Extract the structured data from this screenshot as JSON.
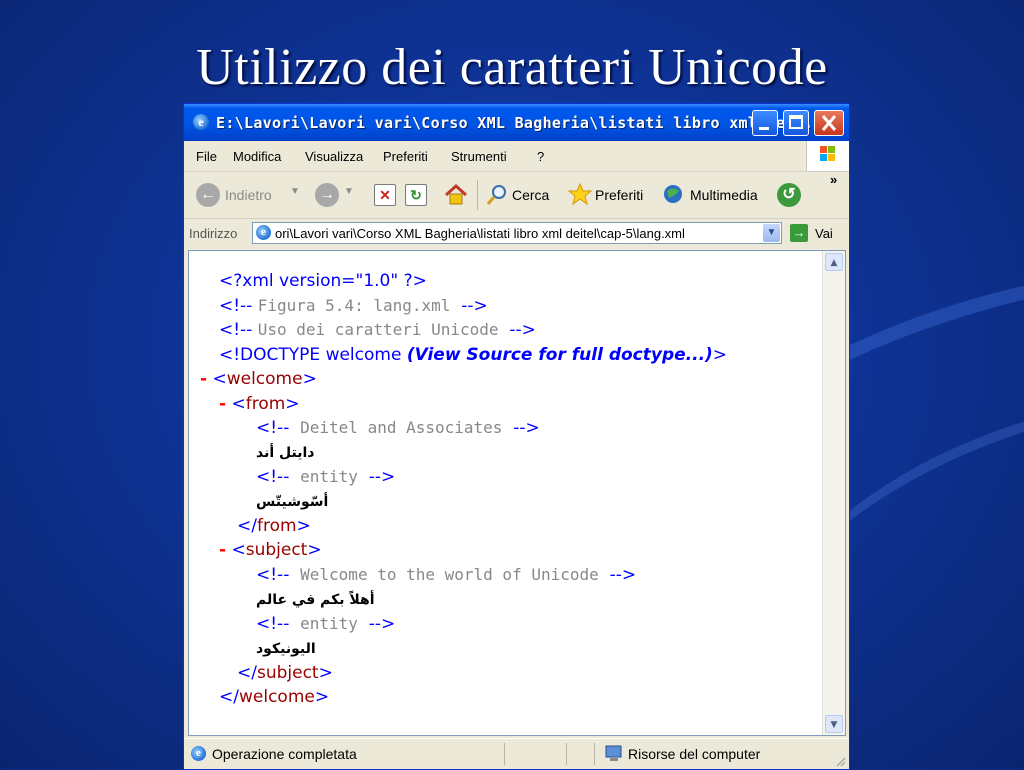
{
  "slide": {
    "title": "Utilizzo dei caratteri Unicode"
  },
  "window": {
    "title": "E:\\Lavori\\Lavori vari\\Corso XML Bagheria\\listati libro xml de...",
    "buttons": [
      "minimize",
      "maximize",
      "close"
    ]
  },
  "menu": {
    "items": [
      "File",
      "Modifica",
      "Visualizza",
      "Preferiti",
      "Strumenti",
      "?"
    ]
  },
  "toolbar": {
    "back_label": "Indietro",
    "search_label": "Cerca",
    "favorites_label": "Preferiti",
    "media_label": "Multimedia",
    "more": "»"
  },
  "address": {
    "label": "Indirizzo",
    "value": "ori\\Lavori vari\\Corso XML Bagheria\\listati libro xml deitel\\cap-5\\lang.xml",
    "go_label": "Vai"
  },
  "document": {
    "xml_decl": "<?xml version=\"1.0\" ?>",
    "c1_open": "<!--",
    "c1_text": "Figura 5.4: lang.xml",
    "c1_close": "-->",
    "c2_open": "<!--",
    "c2_text": "Uso dei caratteri Unicode",
    "c2_close": "-->",
    "doctype_start": "<!DOCTYPE welcome",
    "doctype_note": "(View Source for full doctype...)",
    "doctype_end": ">",
    "collapse": "-",
    "lt": "<",
    "gt": ">",
    "close_lt": "</",
    "welcome": "welcome",
    "from": "from",
    "subject": "subject",
    "c3_open": "<!--",
    "c3_text": "Deitel and Associates",
    "c3_close": "-->",
    "arabic_1": "دايتل أند",
    "c4_open": "<!--",
    "c4_text": "entity",
    "c4_close": "-->",
    "arabic_2": "أسّوشيتّس",
    "c5_open": "<!--",
    "c5_text": "Welcome to the world of Unicode",
    "c5_close": "-->",
    "arabic_3": "أهلاً بكم في عالم",
    "c6_open": "<!--",
    "c6_text": "entity",
    "c6_close": "-->",
    "arabic_4": "اليونيكود"
  },
  "status": {
    "text": "Operazione completata",
    "zone": "Risorse del computer"
  }
}
